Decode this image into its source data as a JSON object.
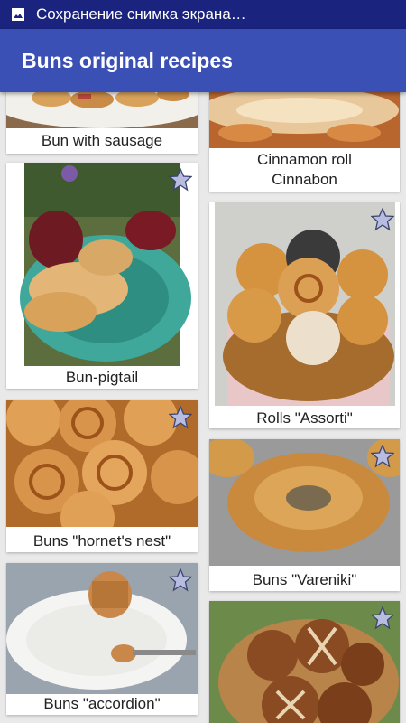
{
  "status_bar": {
    "text": "Сохранение снимка экрана…",
    "icon": "image-icon"
  },
  "app_bar": {
    "title": "Buns original recipes"
  },
  "recipes": [
    {
      "title": "Bun with sausage"
    },
    {
      "title": "Cinnamon roll Cinnabon"
    },
    {
      "title": "Bun-pigtail"
    },
    {
      "title": "Rolls \"Assorti\""
    },
    {
      "title": "Buns \"hornet's nest\""
    },
    {
      "title": "Buns \"Vareniki\""
    },
    {
      "title": "Buns \"accordion\""
    },
    {
      "title": ""
    }
  ],
  "colors": {
    "status_bar": "#1a237e",
    "app_bar": "#3b50b4",
    "star_fill": "#b7bce0",
    "star_stroke": "#3a4470"
  }
}
